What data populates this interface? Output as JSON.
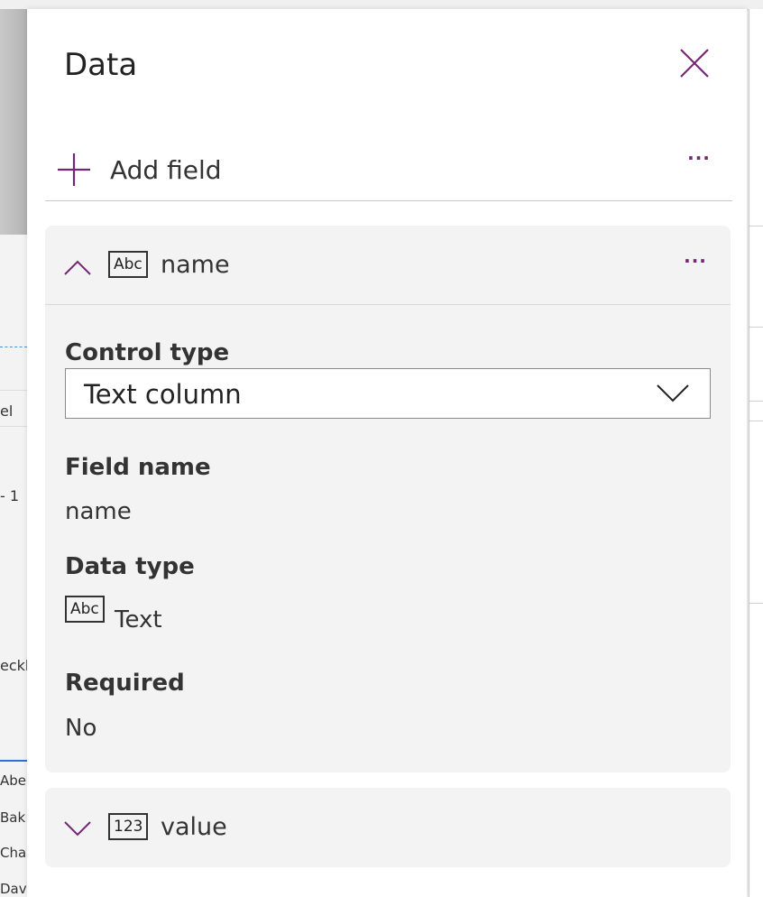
{
  "background": {
    "left_labels": [
      "el",
      "- 1",
      "eckb"
    ],
    "left_list": [
      "Abe",
      "Bak",
      "Cha",
      "Dav"
    ]
  },
  "panel": {
    "title": "Data",
    "add_field_label": "Add field",
    "more_label": "···"
  },
  "fields": [
    {
      "name": "name",
      "type_badge": "Abc",
      "expanded": true,
      "control_type_label": "Control type",
      "control_type_value": "Text column",
      "field_name_label": "Field name",
      "field_name_value": "name",
      "data_type_label": "Data type",
      "data_type_badge": "Abc",
      "data_type_value": "Text",
      "required_label": "Required",
      "required_value": "No"
    },
    {
      "name": "value",
      "type_badge": "123",
      "expanded": false
    }
  ],
  "colors": {
    "accent": "#742774",
    "section_bg": "#f3f3f3"
  }
}
